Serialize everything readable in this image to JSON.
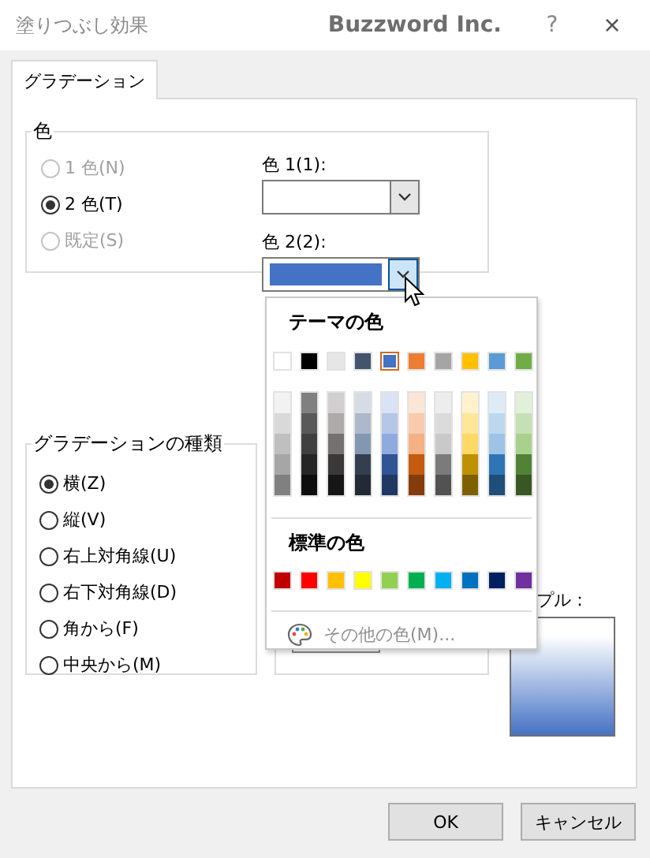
{
  "window": {
    "title": "塗りつぶし効果",
    "brand": "Buzzword Inc.",
    "help": "?",
    "close": "×"
  },
  "tabs": [
    {
      "label": "グラデーション",
      "selected": true
    }
  ],
  "color_group": {
    "label": "色",
    "options": [
      {
        "label": "1 色(N)",
        "selected": false,
        "disabled": true
      },
      {
        "label": "2 色(T)",
        "selected": true,
        "disabled": false
      },
      {
        "label": "既定(S)",
        "selected": false,
        "disabled": true
      }
    ],
    "color1": {
      "label": "色 1(1):",
      "open": false
    },
    "color2": {
      "label": "色 2(2):",
      "color": "#4472c4",
      "open": true
    }
  },
  "popup": {
    "theme_label": "テーマの色",
    "theme_colors": [
      {
        "color": "#ffffff",
        "selected": false
      },
      {
        "color": "#000000",
        "selected": false
      },
      {
        "color": "#e7e6e6",
        "selected": false
      },
      {
        "color": "#44546a",
        "selected": false
      },
      {
        "color": "#4472c4",
        "selected": true
      },
      {
        "color": "#ed7d31",
        "selected": false
      },
      {
        "color": "#a5a5a5",
        "selected": false
      },
      {
        "color": "#ffc000",
        "selected": false
      },
      {
        "color": "#5b9bd5",
        "selected": false
      },
      {
        "color": "#70ad47",
        "selected": false
      }
    ],
    "shade_columns": [
      {
        "shades": [
          {
            "color": "#f2f2f2"
          },
          {
            "color": "#d9d9d9"
          },
          {
            "color": "#bfbfbf"
          },
          {
            "color": "#a6a6a6"
          },
          {
            "color": "#808080"
          }
        ]
      },
      {
        "shades": [
          {
            "color": "#808080"
          },
          {
            "color": "#595959"
          },
          {
            "color": "#404040"
          },
          {
            "color": "#262626"
          },
          {
            "color": "#0d0d0d"
          }
        ]
      },
      {
        "shades": [
          {
            "color": "#d0cece"
          },
          {
            "color": "#aeaaaa"
          },
          {
            "color": "#767171"
          },
          {
            "color": "#3b3838"
          },
          {
            "color": "#171616"
          }
        ]
      },
      {
        "shades": [
          {
            "color": "#d6dce5"
          },
          {
            "color": "#adb9ca"
          },
          {
            "color": "#8497b0"
          },
          {
            "color": "#333f50"
          },
          {
            "color": "#222a35"
          }
        ]
      },
      {
        "shades": [
          {
            "color": "#dae3f3"
          },
          {
            "color": "#b4c7e7"
          },
          {
            "color": "#8faadc"
          },
          {
            "color": "#2f5597"
          },
          {
            "color": "#203864"
          }
        ]
      },
      {
        "shades": [
          {
            "color": "#fbe5d6"
          },
          {
            "color": "#f8cbad"
          },
          {
            "color": "#f4b183"
          },
          {
            "color": "#c55a11"
          },
          {
            "color": "#843c0c"
          }
        ]
      },
      {
        "shades": [
          {
            "color": "#ededed"
          },
          {
            "color": "#dbdbdb"
          },
          {
            "color": "#c9c9c9"
          },
          {
            "color": "#7b7b7b"
          },
          {
            "color": "#525252"
          }
        ]
      },
      {
        "shades": [
          {
            "color": "#fff2cc"
          },
          {
            "color": "#ffe699"
          },
          {
            "color": "#ffd966"
          },
          {
            "color": "#bf9000"
          },
          {
            "color": "#7f6000"
          }
        ]
      },
      {
        "shades": [
          {
            "color": "#deebf7"
          },
          {
            "color": "#bdd7ee"
          },
          {
            "color": "#9dc3e6"
          },
          {
            "color": "#2e75b6"
          },
          {
            "color": "#1f4e79"
          }
        ]
      },
      {
        "shades": [
          {
            "color": "#e2f0d9"
          },
          {
            "color": "#c5e0b4"
          },
          {
            "color": "#a9d18e"
          },
          {
            "color": "#538135"
          },
          {
            "color": "#385723"
          }
        ]
      }
    ],
    "standard_label": "標準の色",
    "standard_colors": [
      {
        "color": "#c00000"
      },
      {
        "color": "#ff0000"
      },
      {
        "color": "#ffc000"
      },
      {
        "color": "#ffff00"
      },
      {
        "color": "#92d050"
      },
      {
        "color": "#00b050"
      },
      {
        "color": "#00b0f0"
      },
      {
        "color": "#0070c0"
      },
      {
        "color": "#002060"
      },
      {
        "color": "#7030a0"
      }
    ],
    "more_label": "その他の色(M)...",
    "more_disabled": true
  },
  "gradient_group": {
    "label": "グラデーションの種類",
    "options": [
      {
        "label": "横(Z)",
        "selected": true
      },
      {
        "label": "縦(V)",
        "selected": false
      },
      {
        "label": "右上対角線(U)",
        "selected": false
      },
      {
        "label": "右下対角線(D)",
        "selected": false
      },
      {
        "label": "角から(F)",
        "selected": false
      },
      {
        "label": "中央から(M)",
        "selected": false
      }
    ]
  },
  "sample": {
    "label": "プル："
  },
  "buttons": [
    {
      "label": "OK"
    },
    {
      "label": "キャンセル"
    }
  ]
}
